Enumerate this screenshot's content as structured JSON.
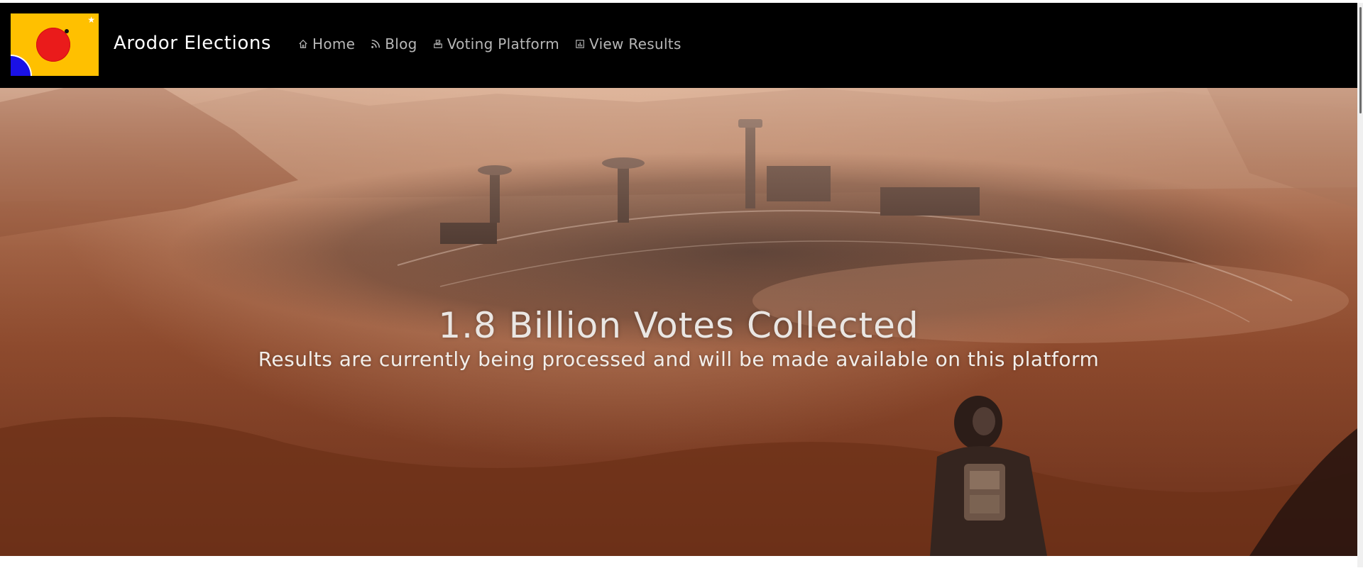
{
  "navbar": {
    "brand": "Arodor Elections",
    "items": [
      {
        "label": "Home",
        "icon": "home-icon"
      },
      {
        "label": "Blog",
        "icon": "rss-icon"
      },
      {
        "label": "Voting Platform",
        "icon": "ballot-icon"
      },
      {
        "label": "View Results",
        "icon": "bar-chart-icon"
      }
    ]
  },
  "hero": {
    "title": "1.8 Billion Votes Collected",
    "subtitle": "Results are currently being processed and will be made available on this platform"
  },
  "colors": {
    "navbar_bg": "#000000",
    "logo_bg": "#ffc000",
    "logo_sun": "#ea1b1b",
    "logo_corner": "#1a11e6",
    "nav_text": "#b7b7b7",
    "hero_text": "#eae6e3"
  }
}
